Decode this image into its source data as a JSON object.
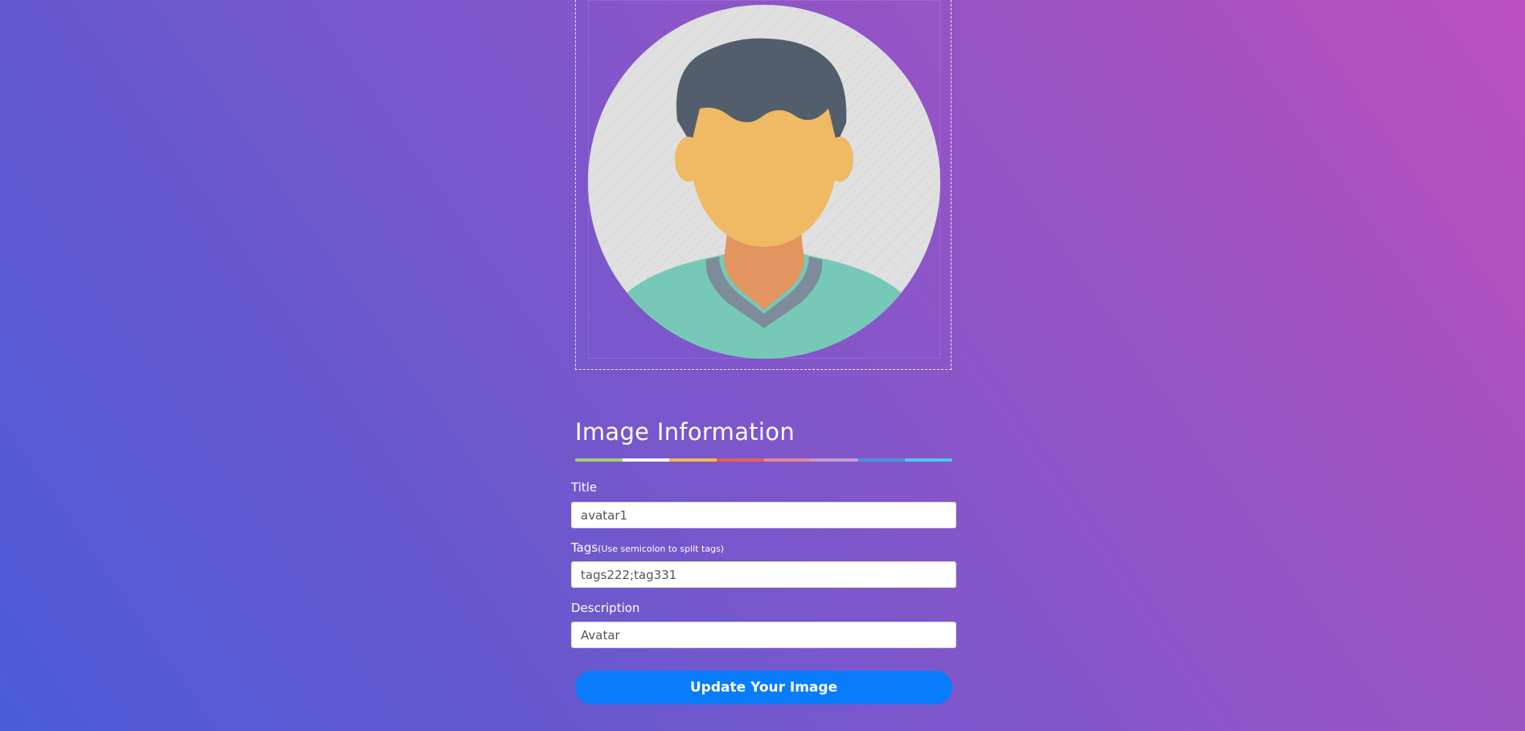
{
  "avatar": {
    "icon": "person-avatar-icon"
  },
  "section": {
    "title": "Image Information",
    "rainbow_colors": [
      "#a6cf6e",
      "#ffffff",
      "#f2b84b",
      "#e0615b",
      "#e3879a",
      "#c59ad8",
      "#4f8fd8",
      "#4fc7e8"
    ]
  },
  "form": {
    "title_label": "Title",
    "title_value": "avatar1",
    "tags_label": "Tags",
    "tags_hint": "(Use semicolon to split tags)",
    "tags_value": "tags222;tag331",
    "description_label": "Description",
    "description_value": "Avatar",
    "submit_label": "Update Your Image"
  },
  "colors": {
    "primary_button": "#087cfb",
    "background_start": "#4a5bd6",
    "background_end": "#bd50c0"
  }
}
